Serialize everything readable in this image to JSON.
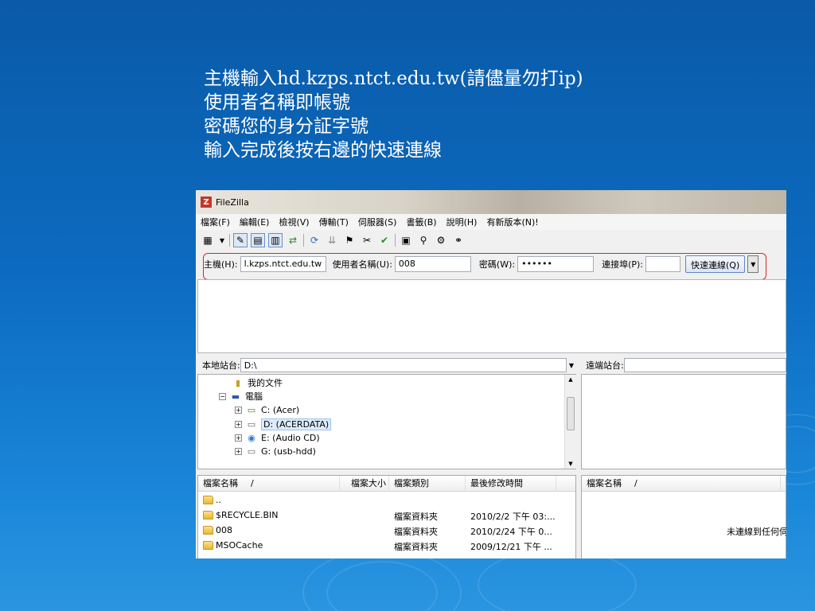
{
  "instructions": [
    "主機輸入hd.kzps.ntct.edu.tw(請儘量勿打ip)",
    "使用者名稱即帳號",
    "密碼您的身分証字號",
    "輸入完成後按右邊的快速連線"
  ],
  "window": {
    "app_icon": "Z",
    "title": "FileZilla"
  },
  "menu": [
    "檔案(F)",
    "編輯(E)",
    "檢視(V)",
    "傳輸(T)",
    "伺服器(S)",
    "書籤(B)",
    "說明(H)",
    "有新版本(N)!"
  ],
  "quickconnect": {
    "host_label": "主機(H):",
    "host_value": "l.kzps.ntct.edu.tw",
    "user_label": "使用者名稱(U):",
    "user_value": "008",
    "pass_label": "密碼(W):",
    "pass_value": "••••••",
    "port_label": "連接埠(P):",
    "port_value": "",
    "button_label": "快速連線(Q)"
  },
  "local": {
    "site_label": "本地站台:",
    "site_value": "D:\\",
    "tree": [
      {
        "label": "我的文件",
        "icon": "documents-icon"
      },
      {
        "label": "電腦",
        "icon": "computer-icon"
      },
      {
        "label": "C: (Acer)",
        "icon": "drive-icon"
      },
      {
        "label": "D: (ACERDATA)",
        "icon": "drive-icon"
      },
      {
        "label": "E: (Audio CD)",
        "icon": "cd-icon"
      },
      {
        "label": "G: (usb-hdd)",
        "icon": "drive-icon"
      }
    ],
    "columns": [
      "檔案名稱",
      "/",
      "檔案大小",
      "檔案類別",
      "最後修改時間"
    ],
    "files": [
      {
        "name": "..",
        "size": "",
        "type": "",
        "modified": ""
      },
      {
        "name": "$RECYCLE.BIN",
        "size": "",
        "type": "檔案資料夾",
        "modified": "2010/2/2 下午 03:..."
      },
      {
        "name": "008",
        "size": "",
        "type": "檔案資料夾",
        "modified": "2010/2/24 下午 0..."
      },
      {
        "name": "MSOCache",
        "size": "",
        "type": "檔案資料夾",
        "modified": "2009/12/21 下午 ..."
      }
    ]
  },
  "remote": {
    "site_label": "遠端站台:",
    "site_value": "",
    "columns": [
      "檔案名稱",
      "/"
    ],
    "status": "未連線到任何伺"
  },
  "colors": {
    "highlight": "#d9262b",
    "selection": "#dcebfc"
  }
}
